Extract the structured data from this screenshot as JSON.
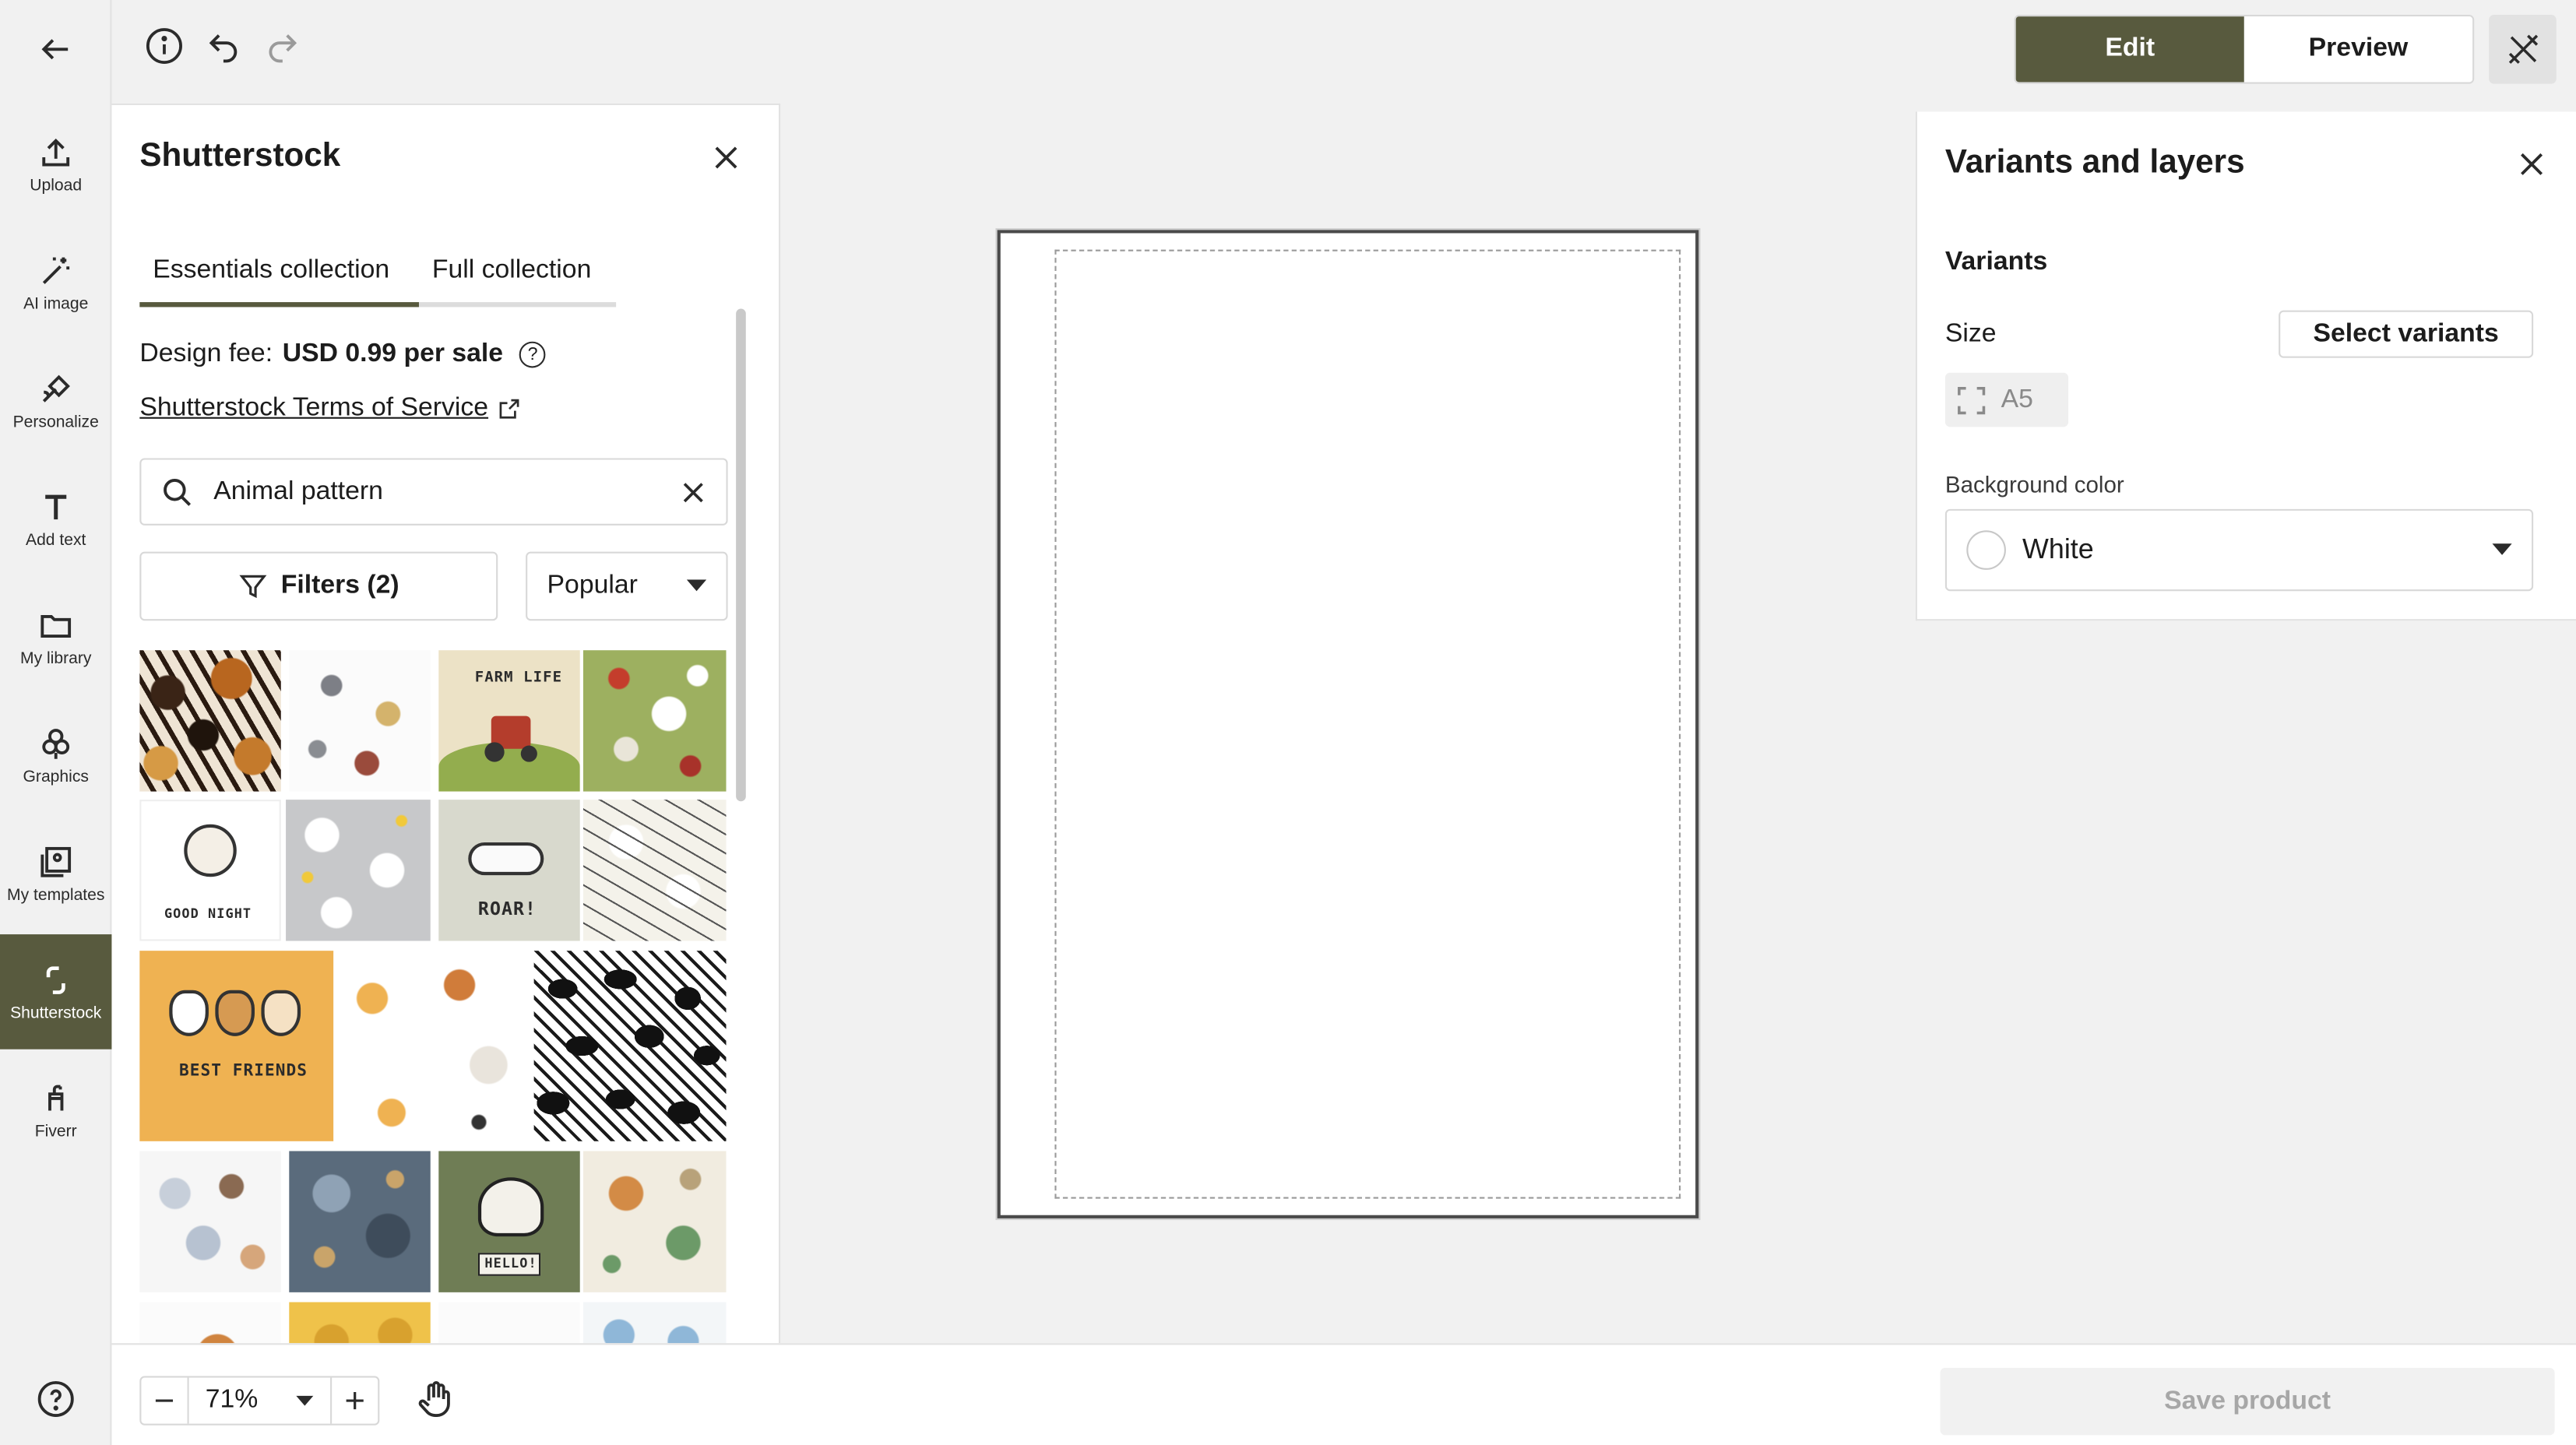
{
  "rail": {
    "items": [
      {
        "label": "Upload"
      },
      {
        "label": "AI image"
      },
      {
        "label": "Personalize"
      },
      {
        "label": "Add text"
      },
      {
        "label": "My library"
      },
      {
        "label": "Graphics"
      },
      {
        "label": "My templates"
      },
      {
        "label": "Shutterstock"
      },
      {
        "label": "Fiverr"
      }
    ],
    "active": "Shutterstock"
  },
  "topbar": {
    "edit_label": "Edit",
    "preview_label": "Preview"
  },
  "panel": {
    "title": "Shutterstock",
    "tabs": [
      {
        "label": "Essentials collection",
        "active": true
      },
      {
        "label": "Full collection",
        "active": false
      }
    ],
    "fee_prefix": "Design fee:",
    "fee_value": "USD 0.99 per sale",
    "tos_label": "Shutterstock Terms of Service",
    "search_value": "Animal pattern",
    "filters_label": "Filters (2)",
    "sort_value": "Popular",
    "thumbnail_captions": [
      "FARM LIFE",
      "GOOD NIGHT",
      "ROAR!",
      "BEST FRIENDS",
      "HELLO!"
    ]
  },
  "right_panel": {
    "title": "Variants and layers",
    "variants_heading": "Variants",
    "size_label": "Size",
    "select_variants_label": "Select variants",
    "size_value": "A5",
    "bg_color_label": "Background color",
    "bg_color_value": "White"
  },
  "bottombar": {
    "zoom_value": "71%",
    "save_label": "Save product"
  },
  "colors": {
    "accent": "#585a3e",
    "background": "#f1f1f1"
  }
}
